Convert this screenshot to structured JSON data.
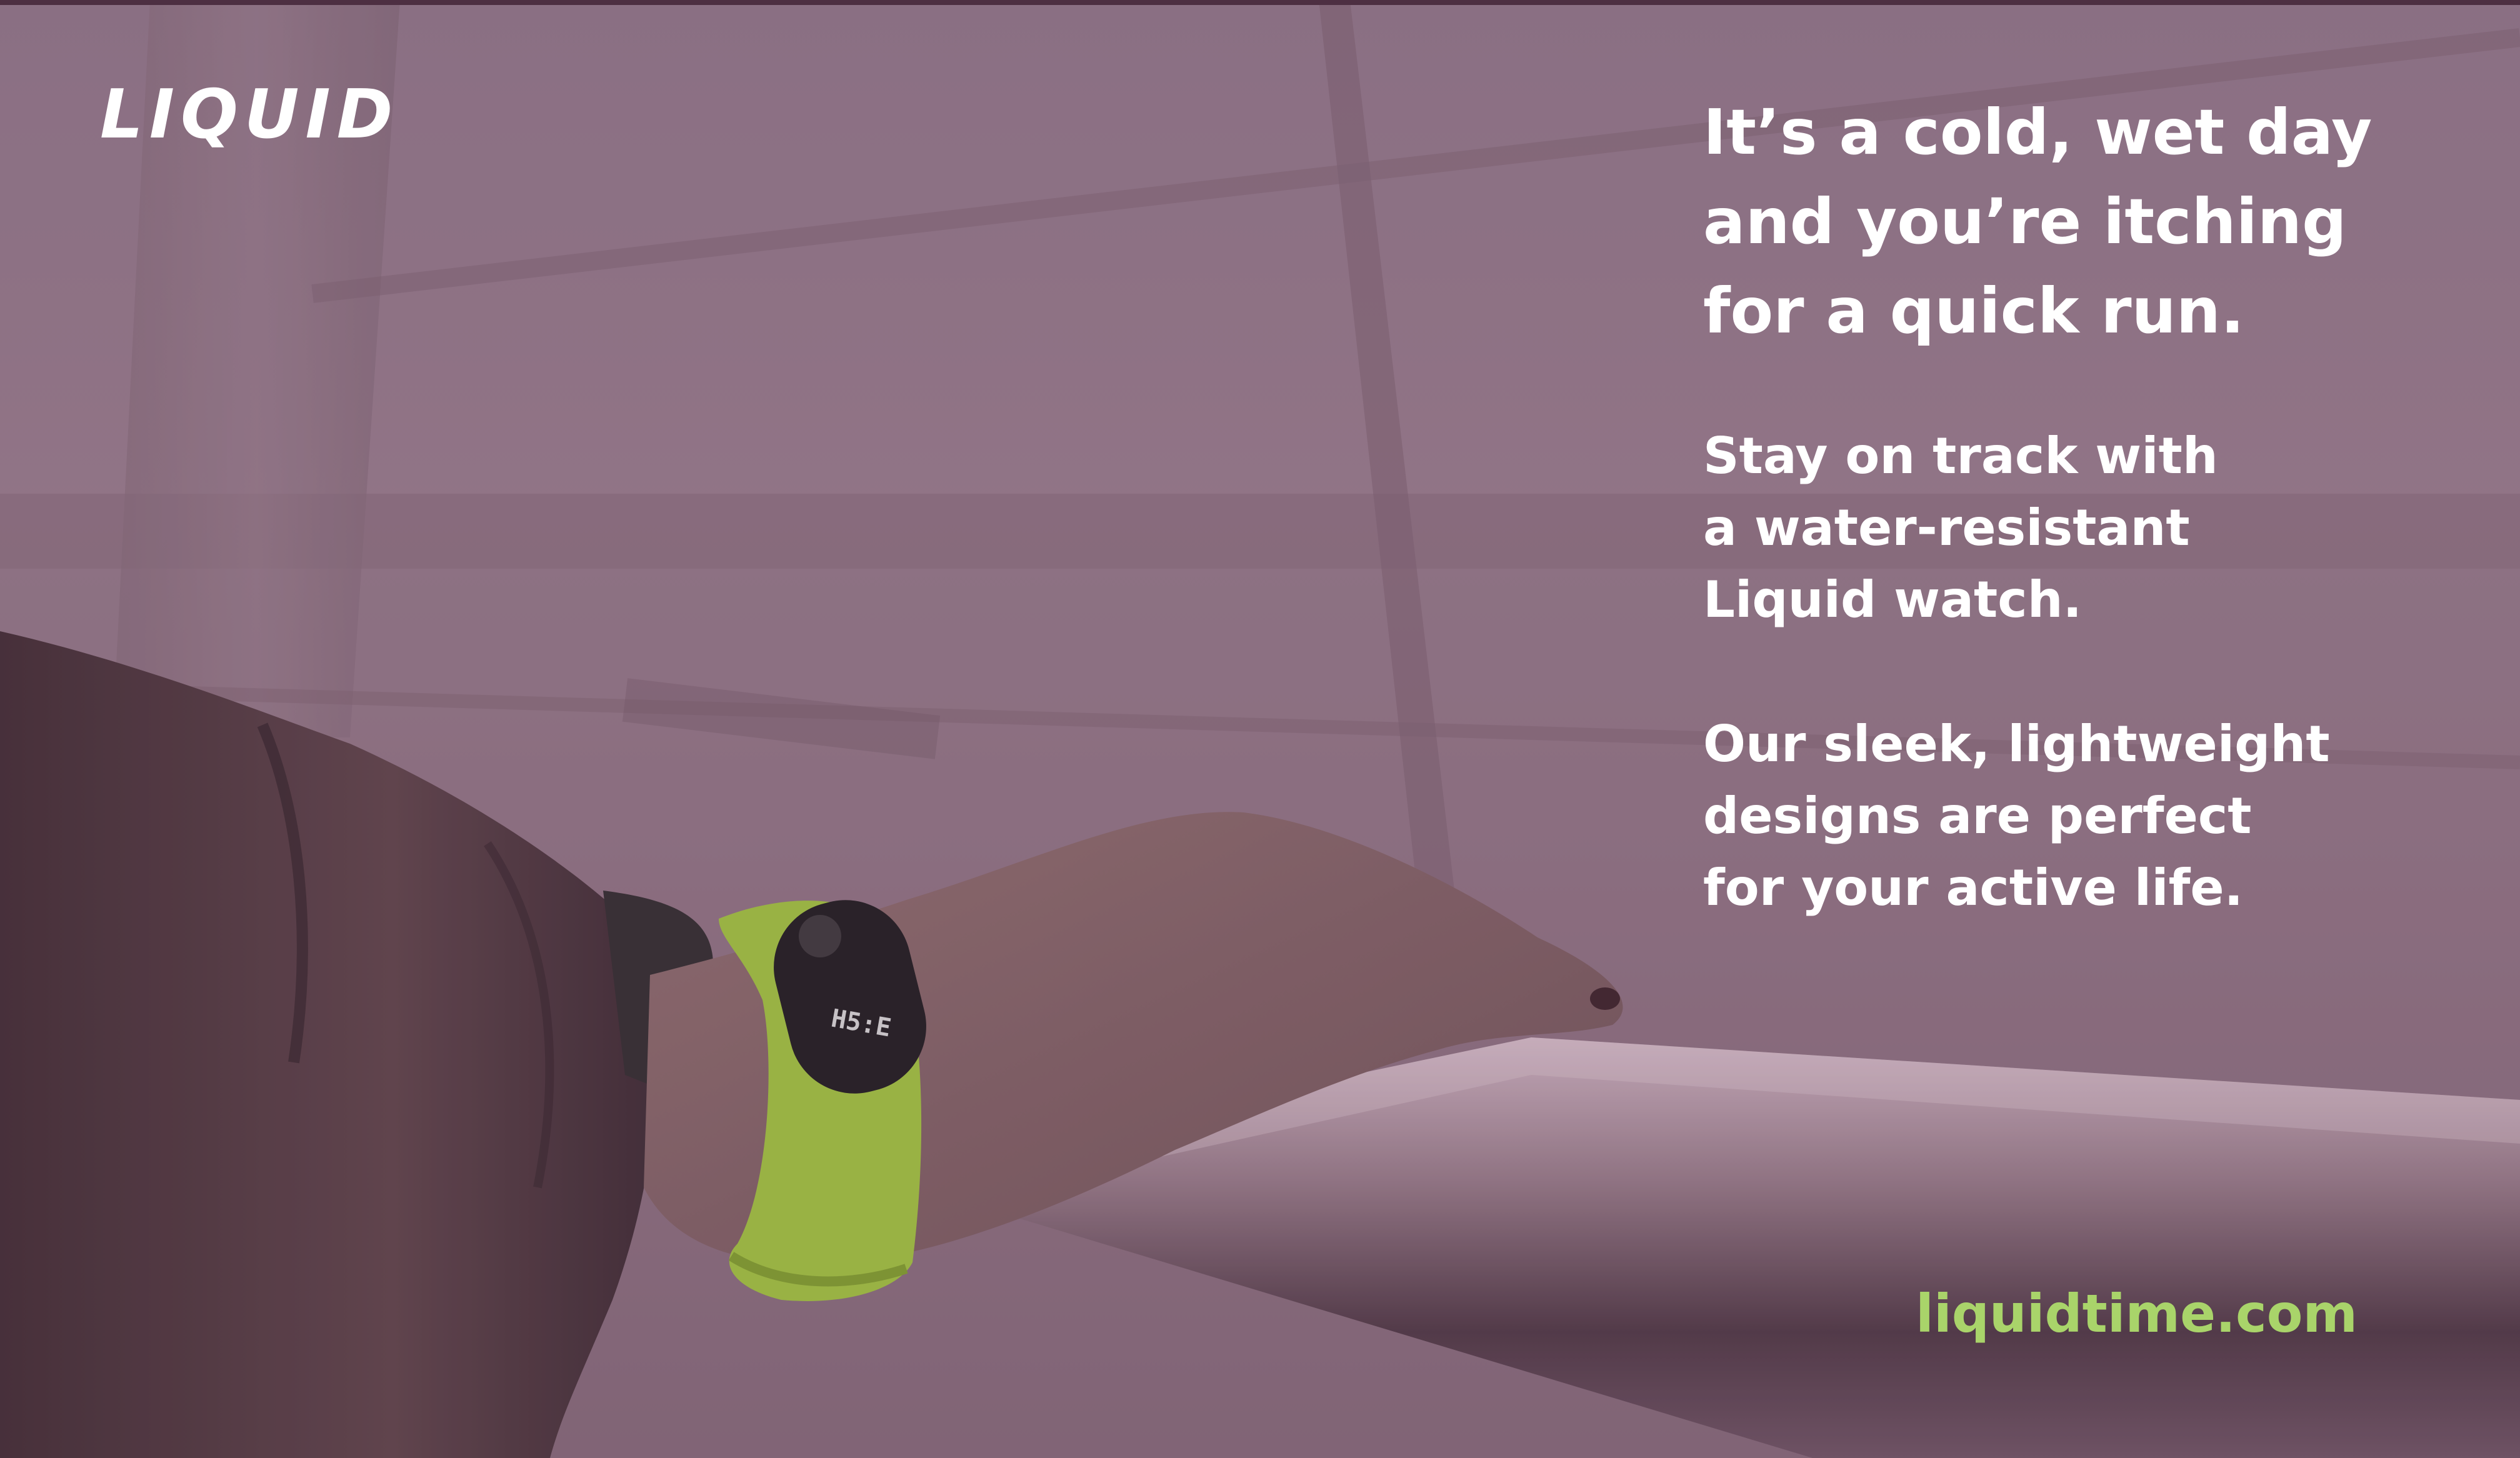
{
  "brand": {
    "logo_text": "LIQUID"
  },
  "headline": {
    "lines": [
      "It’s a cold, wet day",
      "and you’re itching",
      "for a quick run."
    ]
  },
  "body": {
    "paragraph_1": [
      "Stay on track with",
      "a water-resistant",
      "Liquid watch."
    ],
    "paragraph_2": [
      "Our sleek, lightweight",
      "designs are perfect",
      "for your active life."
    ]
  },
  "footer": {
    "url": "liquidtime.com"
  },
  "watch": {
    "display": "H5:E",
    "band_color": "#9bbd3c"
  },
  "colors": {
    "overlay": "#8a7183",
    "text": "#ffffff",
    "accent": "#a9d46a"
  }
}
